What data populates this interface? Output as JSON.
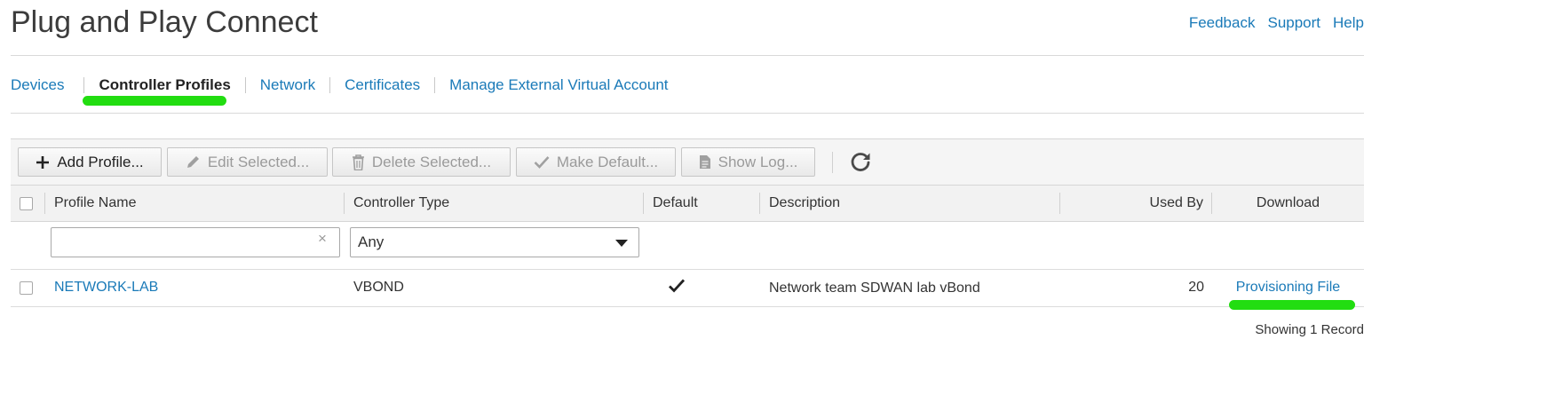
{
  "app": {
    "title": "Plug and Play Connect"
  },
  "top_links": [
    {
      "label": "Feedback"
    },
    {
      "label": "Support"
    },
    {
      "label": "Help"
    }
  ],
  "tabs": [
    {
      "label": "Devices",
      "active": false
    },
    {
      "label": "Controller Profiles",
      "active": true
    },
    {
      "label": "Network",
      "active": false
    },
    {
      "label": "Certificates",
      "active": false
    },
    {
      "label": "Manage External Virtual Account",
      "active": false
    }
  ],
  "toolbar": {
    "add_label": "Add Profile...",
    "edit_label": "Edit Selected...",
    "delete_label": "Delete Selected...",
    "default_label": "Make Default...",
    "log_label": "Show Log..."
  },
  "table": {
    "columns": [
      "Profile Name",
      "Controller Type",
      "Default",
      "Description",
      "Used By",
      "Download"
    ],
    "filters": {
      "profile_name_value": "",
      "controller_type_selected": "Any",
      "clear_symbol": "×"
    },
    "rows": [
      {
        "profile_name": "NETWORK-LAB",
        "controller_type": "VBOND",
        "default": true,
        "description": "Network team SDWAN lab vBond",
        "used_by": "20",
        "download": "Provisioning File"
      }
    ]
  },
  "footer": {
    "record_count": "Showing 1 Record"
  },
  "colors": {
    "link": "#1a7ab8",
    "highlight": "#22dd11",
    "header_bg": "#f2f2f2",
    "toolbar_bg": "#f5f5f5"
  }
}
